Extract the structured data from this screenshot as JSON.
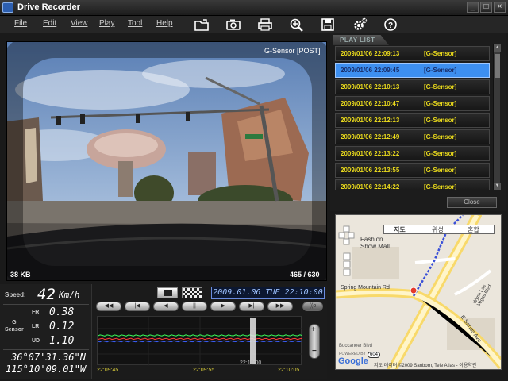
{
  "window": {
    "title": "Drive Recorder",
    "minimize": "_",
    "maximize": "□",
    "close": "×"
  },
  "menu": [
    "File",
    "Edit",
    "View",
    "Play",
    "Tool",
    "Help"
  ],
  "toolbar_icons": [
    "folder-icon",
    "camera-icon",
    "print-icon",
    "zoom-icon",
    "save-icon",
    "settings-icon",
    "help-icon"
  ],
  "video": {
    "mode_label": "G-Sensor [POST]",
    "size_label": "38 KB",
    "frame_label": "465 / 630"
  },
  "playlist": {
    "tab_label": "PLAY LIST",
    "items": [
      {
        "time": "2009/01/06 22:09:13",
        "tag": "[G-Sensor]"
      },
      {
        "time": "2009/01/06 22:09:45",
        "tag": "[G-Sensor]"
      },
      {
        "time": "2009/01/06 22:10:13",
        "tag": "[G-Sensor]"
      },
      {
        "time": "2009/01/06 22:10:47",
        "tag": "[G-Sensor]"
      },
      {
        "time": "2009/01/06 22:12:13",
        "tag": "[G-Sensor]"
      },
      {
        "time": "2009/01/06 22:12:49",
        "tag": "[G-Sensor]"
      },
      {
        "time": "2009/01/06 22:13:22",
        "tag": "[G-Sensor]"
      },
      {
        "time": "2009/01/06 22:13:55",
        "tag": "[G-Sensor]"
      },
      {
        "time": "2009/01/06 22:14:22",
        "tag": "[G-Sensor]"
      }
    ],
    "selected_index": 1,
    "close_label": "Close"
  },
  "map": {
    "tabs": [
      "지도",
      "위성",
      "혼합"
    ],
    "labels": {
      "fashion": "Fashion\nShow Mall",
      "spring": "Spring Mountain Rd",
      "wynn": "Wynn Las\nVegas Blvd",
      "sands": "E Sands Ave",
      "buccaneer": "Buccaneer Blvd",
      "route": "604"
    },
    "powered": "POWERED BY",
    "google": "Google",
    "copyright": "지도 데이터 ©2009 Sanborn, Tele Atlas - 이용약관"
  },
  "info": {
    "speed_label": "Speed:",
    "speed_value": "42",
    "speed_unit": "Km/h",
    "g_label": "G\nSensor",
    "fr_label": "FR",
    "fr_value": "0.38",
    "lr_label": "LR",
    "lr_value": "0.12",
    "ud_label": "UD",
    "ud_value": "1.10",
    "lat": "36°07'31.36\"N",
    "lon": "115°10'09.01\"W"
  },
  "controls": {
    "datetime": "2009.01.06 TUE 22:10:00",
    "buttons": [
      "◀◀",
      "|◀",
      "◀",
      "||",
      "▶",
      "▶|",
      "▶▶"
    ],
    "extra_button": "((o",
    "graph_ticks": [
      "22:09:45",
      "22:09:55",
      "22:10:00",
      "22:10:05"
    ],
    "zoom_in": "+",
    "zoom_out": "−"
  },
  "graph_data": {
    "type": "line",
    "x": [
      "22:09:45",
      "22:09:55",
      "22:10:05"
    ],
    "series": [
      {
        "color": "#3a60ff",
        "level": 0.5
      },
      {
        "color": "#ff3a3a",
        "level": 0.55
      },
      {
        "color": "#3aff5a",
        "level": 0.62
      }
    ]
  }
}
